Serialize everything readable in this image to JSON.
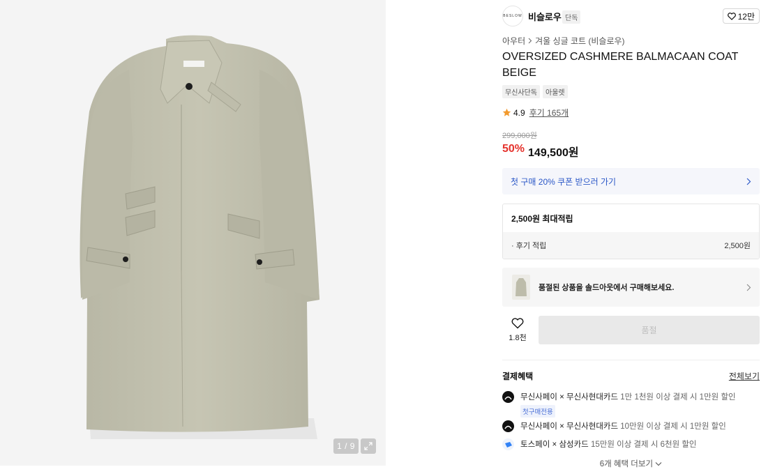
{
  "gallery": {
    "counter": "1 / 9"
  },
  "brand": {
    "logo_text": "BESLOW",
    "name": "비슬로우",
    "badge": "단독",
    "likes": "12만"
  },
  "breadcrumb": {
    "parent": "아우터",
    "current": "겨울 싱글 코트 (비슬로우)"
  },
  "product": {
    "title": "OVERSIZED CASHMERE BALMACAAN COAT BEIGE",
    "tags": [
      "무신사단독",
      "아울렛"
    ],
    "rating": "4.9",
    "reviews": "후기 165개",
    "original_price": "299,000원",
    "discount": "50%",
    "price": "149,500원"
  },
  "coupon": {
    "label": "첫 구매 20% 쿠폰 받으러 가기"
  },
  "points": {
    "head": "2,500원 최대적립",
    "row_label": "· 후기 적립",
    "row_value": "2,500원"
  },
  "soldout": {
    "message": "품절된 상품을 솔드아웃에서 구매해보세요."
  },
  "actions": {
    "wish_count": "1.8천",
    "buy_label": "품절"
  },
  "benefits": {
    "title": "결제혜택",
    "view_all": "전체보기",
    "items": [
      {
        "pay": "무신사페이",
        "card": "무신사현대카드",
        "cond": "1만 1천원 이상 결제 시 1만원 할인",
        "sub": "첫구매전용"
      },
      {
        "pay": "무신사페이",
        "card": "무신사현대카드",
        "cond": "10만원 이상 결제 시 1만원 할인",
        "sub": ""
      },
      {
        "pay": "토스페이",
        "card": "삼성카드",
        "cond": "15만원 이상 결제 시 6천원 할인",
        "sub": ""
      }
    ],
    "more": "6개 혜택 더보기"
  },
  "colors": {
    "accent_red": "#e5332d",
    "coupon_blue": "#2a57c7",
    "coat_beige": "#c3c2b0"
  }
}
